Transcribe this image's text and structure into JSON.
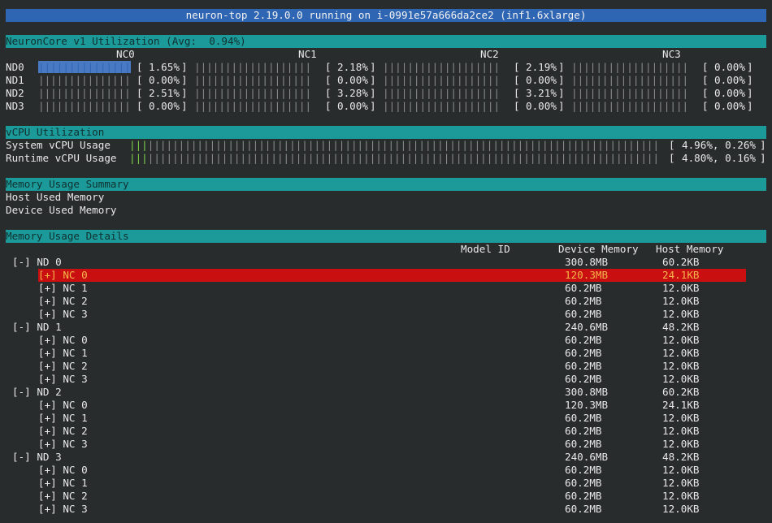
{
  "title": "neuron-top 2.19.0.0 running on i-0991e57a666da2ce2 (inf1.6xlarge)",
  "core_section": {
    "header": "NeuronCore v1 Utilization (Avg:  0.94%)",
    "columns": [
      "NC0",
      "NC1",
      "NC2",
      "NC3"
    ],
    "rows": [
      {
        "label": "ND0",
        "values": [
          "1.65%",
          "2.18%",
          "2.19%",
          "0.00%"
        ],
        "fill": [
          1,
          0,
          0,
          0
        ]
      },
      {
        "label": "ND1",
        "values": [
          "0.00%",
          "0.00%",
          "0.00%",
          "0.00%"
        ],
        "fill": [
          0,
          0,
          0,
          0
        ]
      },
      {
        "label": "ND2",
        "values": [
          "2.51%",
          "3.28%",
          "3.21%",
          "0.00%"
        ],
        "fill": [
          0,
          0,
          0,
          0
        ]
      },
      {
        "label": "ND3",
        "values": [
          "0.00%",
          "0.00%",
          "0.00%",
          "0.00%"
        ],
        "fill": [
          0,
          0,
          0,
          0
        ]
      }
    ]
  },
  "vcpu_section": {
    "header": "vCPU Utilization",
    "rows": [
      {
        "label": "System vCPU Usage",
        "value": "4.96%, 0.26%"
      },
      {
        "label": "Runtime vCPU Usage",
        "value": "4.80%, 0.16%"
      }
    ]
  },
  "memory_summary": {
    "header": "Memory Usage Summary",
    "host_label": "Host Used Memory",
    "device_label": "Device Used Memory"
  },
  "memory_details": {
    "header": "Memory Usage Details",
    "col_model": "Model ID",
    "col_device": "Device Memory",
    "col_host": "Host Memory",
    "rows": [
      {
        "text": "[-] ND 0",
        "indent": 0,
        "device": "300.8MB",
        "host": "60.2KB"
      },
      {
        "text": "[+] NC 0",
        "indent": 1,
        "device": "120.3MB",
        "host": "24.1KB",
        "selected": true
      },
      {
        "text": "[+] NC 1",
        "indent": 1,
        "device": "60.2MB",
        "host": "12.0KB"
      },
      {
        "text": "[+] NC 2",
        "indent": 1,
        "device": "60.2MB",
        "host": "12.0KB"
      },
      {
        "text": "[+] NC 3",
        "indent": 1,
        "device": "60.2MB",
        "host": "12.0KB"
      },
      {
        "text": "[-] ND 1",
        "indent": 0,
        "device": "240.6MB",
        "host": "48.2KB"
      },
      {
        "text": "[+] NC 0",
        "indent": 1,
        "device": "60.2MB",
        "host": "12.0KB"
      },
      {
        "text": "[+] NC 1",
        "indent": 1,
        "device": "60.2MB",
        "host": "12.0KB"
      },
      {
        "text": "[+] NC 2",
        "indent": 1,
        "device": "60.2MB",
        "host": "12.0KB"
      },
      {
        "text": "[+] NC 3",
        "indent": 1,
        "device": "60.2MB",
        "host": "12.0KB"
      },
      {
        "text": "[-] ND 2",
        "indent": 0,
        "device": "300.8MB",
        "host": "60.2KB"
      },
      {
        "text": "[+] NC 0",
        "indent": 1,
        "device": "120.3MB",
        "host": "24.1KB"
      },
      {
        "text": "[+] NC 1",
        "indent": 1,
        "device": "60.2MB",
        "host": "12.0KB"
      },
      {
        "text": "[+] NC 2",
        "indent": 1,
        "device": "60.2MB",
        "host": "12.0KB"
      },
      {
        "text": "[+] NC 3",
        "indent": 1,
        "device": "60.2MB",
        "host": "12.0KB"
      },
      {
        "text": "[-] ND 3",
        "indent": 0,
        "device": "240.6MB",
        "host": "48.2KB"
      },
      {
        "text": "[+] NC 0",
        "indent": 1,
        "device": "60.2MB",
        "host": "12.0KB"
      },
      {
        "text": "[+] NC 1",
        "indent": 1,
        "device": "60.2MB",
        "host": "12.0KB"
      },
      {
        "text": "[+] NC 2",
        "indent": 1,
        "device": "60.2MB",
        "host": "12.0KB"
      },
      {
        "text": "[+] NC 3",
        "indent": 1,
        "device": "60.2MB",
        "host": "12.0KB"
      }
    ]
  },
  "colors": {
    "title_bg": "#2f66b3",
    "section_bg": "#1c9a9a",
    "selected_bg": "#c90f0f",
    "selected_fg": "#f4b64a",
    "bar_blue": "#4a79c4",
    "bar_green": "#7fd14a"
  }
}
